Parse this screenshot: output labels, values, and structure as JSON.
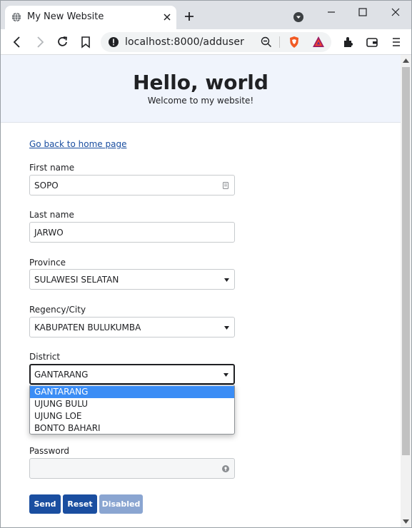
{
  "browser": {
    "tab_title": "My New Website",
    "url": "localhost:8000/adduser"
  },
  "page": {
    "heading": "Hello, world",
    "subheading": "Welcome to my website!",
    "back_link": "Go back to home page",
    "form": {
      "first_name": {
        "label": "First name",
        "value": "SOPO"
      },
      "last_name": {
        "label": "Last name",
        "value": "JARWO"
      },
      "province": {
        "label": "Province",
        "value": "SULAWESI SELATAN"
      },
      "regency": {
        "label": "Regency/City",
        "value": "KABUPATEN BULUKUMBA"
      },
      "district": {
        "label": "District",
        "value": "GANTARANG",
        "options": [
          "GANTARANG",
          "UJUNG BULU",
          "UJUNG LOE",
          "BONTO BAHARI"
        ],
        "highlighted_index": 0
      },
      "password": {
        "label": "Password",
        "value": ""
      }
    },
    "buttons": {
      "send": "Send",
      "reset": "Reset",
      "disabled": "Disabled"
    }
  },
  "colors": {
    "primary": "#1a4ea0",
    "primary_disabled": "#8aa5d1",
    "hero_bg": "#f0f4fc",
    "option_highlight": "#3b8df5"
  }
}
